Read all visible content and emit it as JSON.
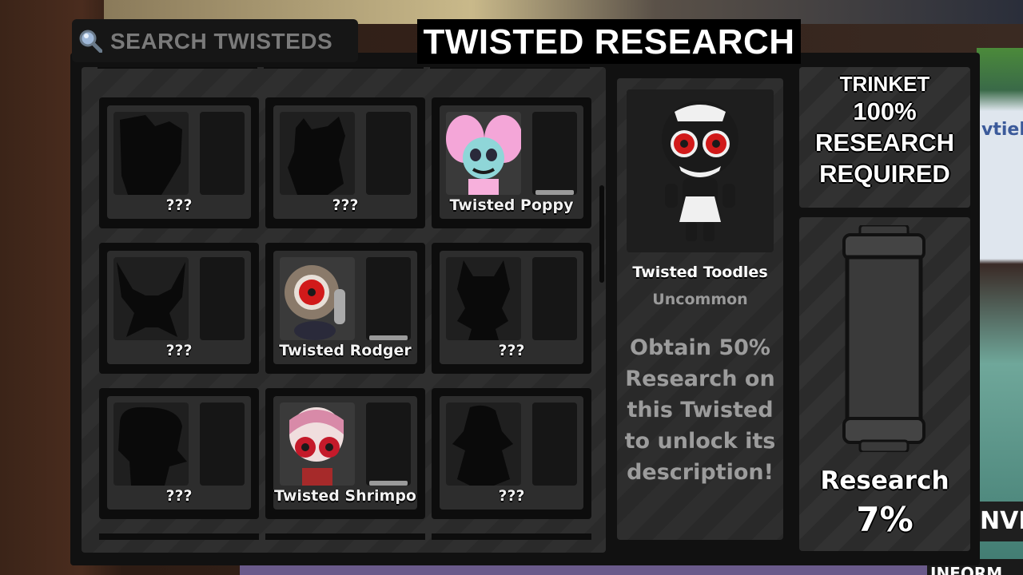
{
  "header": {
    "search_placeholder": "SEARCH TWISTEDS",
    "title": "TWISTED RESEARCH"
  },
  "grid": {
    "cards": [
      {
        "name": "???",
        "unlocked": false,
        "research_progress": 0
      },
      {
        "name": "???",
        "unlocked": false,
        "research_progress": 0
      },
      {
        "name": "Twisted Poppy",
        "unlocked": true,
        "research_progress": 1
      },
      {
        "name": "???",
        "unlocked": false,
        "research_progress": 0
      },
      {
        "name": "Twisted Rodger",
        "unlocked": true,
        "research_progress": 1
      },
      {
        "name": "???",
        "unlocked": false,
        "research_progress": 0
      },
      {
        "name": "???",
        "unlocked": false,
        "research_progress": 0
      },
      {
        "name": "Twisted Shrimpo",
        "unlocked": true,
        "research_progress": 1
      },
      {
        "name": "???",
        "unlocked": false,
        "research_progress": 0
      }
    ]
  },
  "detail": {
    "name": "Twisted Toodles",
    "rarity": "Uncommon",
    "description": "Obtain 50% Research on this Twisted to unlock its description!"
  },
  "trinket": {
    "line1": "TRINKET",
    "line2": "100%",
    "line3": "RESEARCH",
    "line4": "REQUIRED"
  },
  "research": {
    "label": "Research",
    "value": "7%",
    "fraction": 0.07
  },
  "background": {
    "partial_text_1": "vtiel)",
    "partial_text_2": "NVIT",
    "partial_text_3": "INFORM"
  },
  "colors": {
    "panel": "#111111",
    "card": "#2d2d2d",
    "text_primary": "#ffffff",
    "text_muted": "#9a9a9a"
  }
}
